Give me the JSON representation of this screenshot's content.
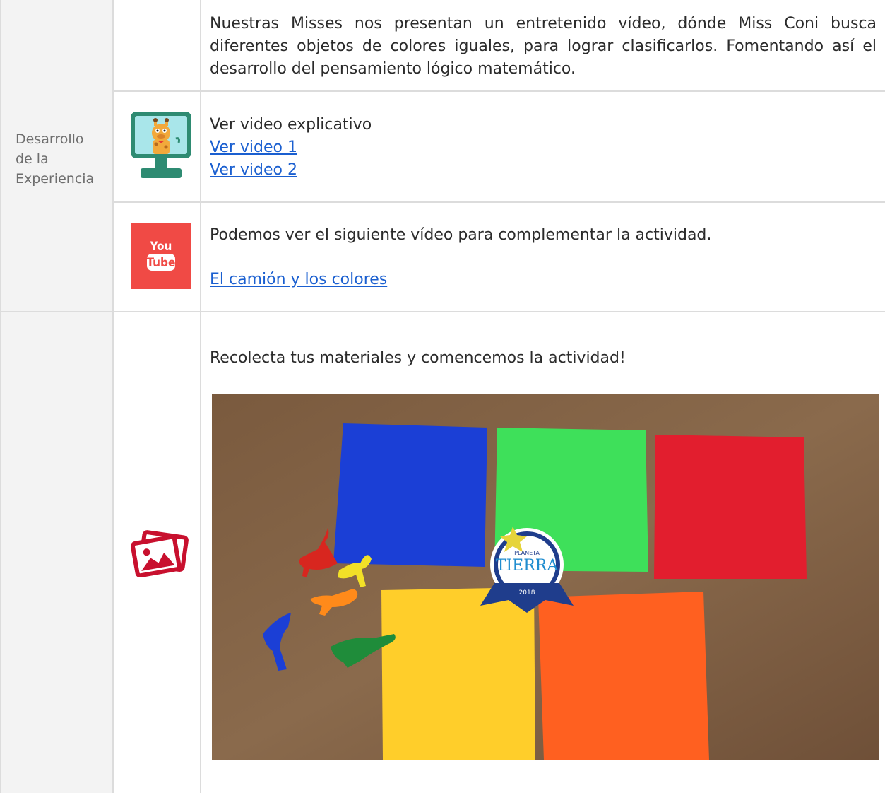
{
  "stage": {
    "label_line1": "Desarrollo",
    "label_line2": "de la",
    "label_line3": "Experiencia"
  },
  "row_intro": {
    "text": "Nuestras Misses nos presentan un entretenido vídeo, dónde Miss Coni busca diferentes objetos de colores iguales, para lograr clasificarlos. Fomentando así el desarrollo del pensamiento lógico matemático."
  },
  "row_video": {
    "icon": "monitor-giraffe-icon",
    "title": "Ver video explicativo",
    "link1": "Ver video 1",
    "link2": "Ver video 2"
  },
  "row_youtube": {
    "icon": "youtube-icon",
    "icon_text_top": "You",
    "icon_text_bottom": "Tube",
    "text": "Podemos ver el siguiente vídeo para complementar la actividad.",
    "link": "El camión y los colores"
  },
  "row_materials": {
    "icon": "images-icon",
    "text": "Recolecta tus materiales y comencemos la actividad!",
    "photo_badge_top": "PLANETA",
    "photo_badge_main": "TIERRA",
    "photo_badge_year": "2018"
  },
  "colors": {
    "border": "#dcdcdc",
    "label_bg": "#f3f3f3",
    "link": "#1a5fd0",
    "youtube_red": "#f04a45",
    "icon_red": "#c8102e",
    "monitor_green": "#2e8b72"
  }
}
